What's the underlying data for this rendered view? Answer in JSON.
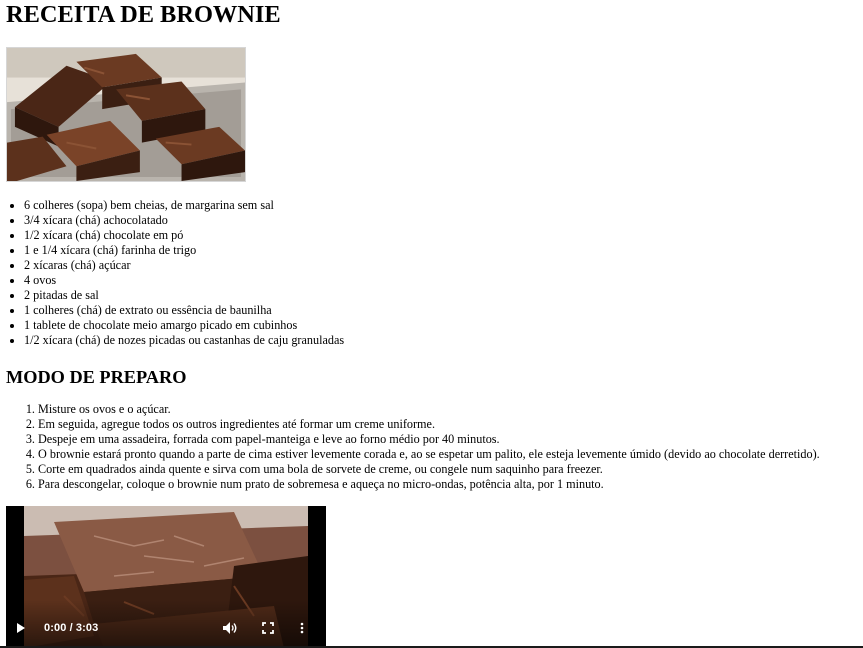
{
  "recipe": {
    "title": "RECEITA DE BROWNIE",
    "ingredients": [
      "6 colheres (sopa) bem cheias, de margarina sem sal",
      "3/4 xícara (chá) achocolatado",
      "1/2 xícara (chá) chocolate em pó",
      "1 e 1/4 xícara (chá) farinha de trigo",
      "2 xícaras (chá) açúcar",
      "4 ovos",
      "2 pitadas de sal",
      "1 colheres (chá) de extrato ou essência de baunilha",
      "1 tablete de chocolate meio amargo picado em cubinhos",
      "1/2 xícara (chá) de nozes picadas ou castanhas de caju granuladas"
    ],
    "method_title": "MODO DE PREPARO",
    "steps": [
      "Misture os ovos e o açúcar.",
      "Em seguida, agregue todos os outros ingredientes até formar um creme uniforme.",
      "Despeje em uma assadeira, forrada com papel-manteiga e leve ao forno médio por 40 minutos.",
      "O brownie estará pronto quando a parte de cima estiver levemente corada e, ao se espetar um palito, ele esteja levemente úmido (devido ao chocolate derretido).",
      "Corte em quadrados ainda quente e sirva com uma bola de sorvete de creme, ou congele num saquinho para freezer.",
      "Para descongelar, coloque o brownie num prato de sobremesa e aqueça no micro-ondas, potência alta, por 1 minuto."
    ]
  },
  "video": {
    "time_display": "0:00 / 3:03",
    "play_icon": "play-icon",
    "volume_icon": "volume-icon",
    "fullscreen_icon": "fullscreen-icon",
    "more_icon": "more-options-icon"
  },
  "colors": {
    "brownie_dark": "#3b1f12",
    "brownie_mid": "#6b3a22",
    "tray": "#b9b4ad"
  }
}
